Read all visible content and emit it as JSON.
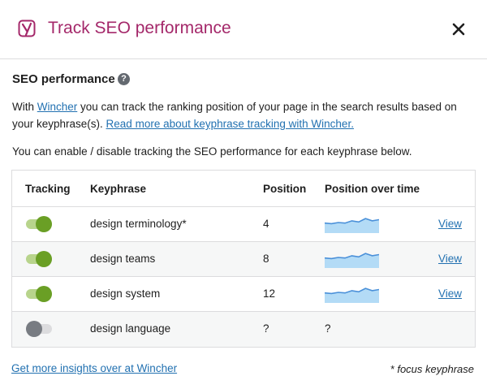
{
  "header": {
    "title": "Track SEO performance",
    "brand_color": "#a4286a"
  },
  "section": {
    "title": "SEO performance",
    "help_glyph": "?"
  },
  "intro": {
    "prefix": "With ",
    "wincher_link": "Wincher",
    "middle": " you can track the ranking position of your page in the search results based on",
    "line2_prefix": "your keyphrase(s). ",
    "read_more_link": "Read more about keyphrase tracking with Wincher."
  },
  "enable_text": "You can enable / disable tracking the SEO performance for each keyphrase below.",
  "table": {
    "columns": {
      "tracking": "Tracking",
      "keyphrase": "Keyphrase",
      "position": "Position",
      "position_over_time": "Position over time"
    },
    "rows": [
      {
        "tracking": true,
        "keyphrase": "design terminology*",
        "position": "4",
        "trend": [
          0.55,
          0.6,
          0.5,
          0.55,
          0.35,
          0.45,
          0.15,
          0.35,
          0.25
        ],
        "action": "View"
      },
      {
        "tracking": true,
        "keyphrase": "design teams",
        "position": "8",
        "trend": [
          0.55,
          0.6,
          0.5,
          0.55,
          0.35,
          0.45,
          0.15,
          0.35,
          0.25
        ],
        "action": "View"
      },
      {
        "tracking": true,
        "keyphrase": "design system",
        "position": "12",
        "trend": [
          0.55,
          0.6,
          0.5,
          0.55,
          0.35,
          0.45,
          0.15,
          0.35,
          0.25
        ],
        "action": "View"
      },
      {
        "tracking": false,
        "keyphrase": "design language",
        "position": "?",
        "trend_text": "?",
        "action": ""
      }
    ]
  },
  "footer": {
    "insights_link": "Get more insights over at Wincher",
    "footnote": "* focus keyphrase"
  },
  "colors": {
    "link": "#2271b1",
    "toggle_on": "#6a9f25",
    "toggle_off": "#787c82",
    "spark_line": "#4a90d9",
    "spark_fill": "#b3dbf6"
  },
  "icons": {
    "logo": "yoast-logo-icon",
    "close": "close-icon",
    "help": "help-icon"
  }
}
